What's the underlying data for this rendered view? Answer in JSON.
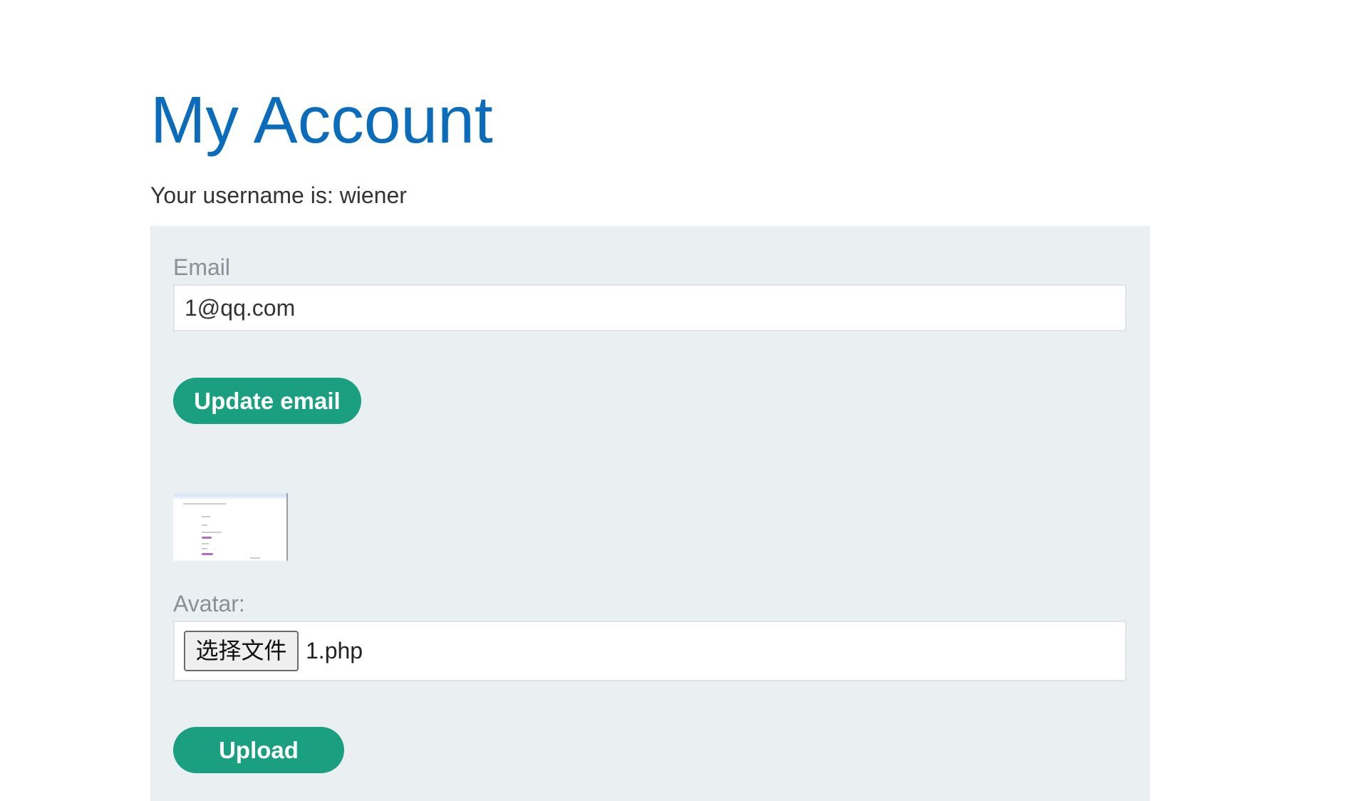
{
  "page": {
    "title": "My Account",
    "username_text": "Your username is: wiener"
  },
  "email_form": {
    "label": "Email",
    "value": "1@qq.com",
    "submit_label": "Update email"
  },
  "avatar_form": {
    "label": "Avatar:",
    "choose_file_label": "选择文件",
    "selected_file": "1.php",
    "submit_label": "Upload"
  },
  "colors": {
    "title": "#0b6cbc",
    "button": "#1a9f80",
    "panel_background": "#eaeff2"
  }
}
